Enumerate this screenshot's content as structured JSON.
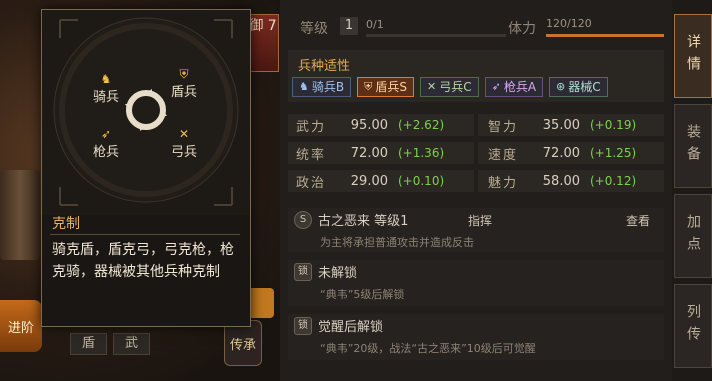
{
  "background": {
    "left_badge": "进阶",
    "red_tag": "御 7",
    "sub_tabs": [
      "盾",
      "武"
    ],
    "chuan": "传承"
  },
  "header": {
    "level_label": "等级",
    "level_value": "1",
    "level_progress": "0/1",
    "stamina_label": "体力",
    "stamina_value": "120/120",
    "stamina_fill": 1.0
  },
  "troop_affinity": {
    "title": "兵种适性",
    "chips": [
      {
        "label": "骑兵B",
        "icon": "horse-icon"
      },
      {
        "label": "盾兵S",
        "icon": "shield-icon",
        "active": true
      },
      {
        "label": "弓兵C",
        "icon": "bow-icon"
      },
      {
        "label": "枪兵A",
        "icon": "spear-icon"
      },
      {
        "label": "器械C",
        "icon": "siege-icon"
      }
    ]
  },
  "stats": [
    {
      "label": "武力",
      "value": "95.00",
      "bonus": "(+2.62)"
    },
    {
      "label": "智力",
      "value": "35.00",
      "bonus": "(+0.19)"
    },
    {
      "label": "统率",
      "value": "72.00",
      "bonus": "(+1.36)"
    },
    {
      "label": "速度",
      "value": "72.00",
      "bonus": "(+1.25)"
    },
    {
      "label": "政治",
      "value": "29.00",
      "bonus": "(+0.10)"
    },
    {
      "label": "魅力",
      "value": "58.00",
      "bonus": "(+0.12)"
    }
  ],
  "skills": [
    {
      "icon": "S",
      "name": "古之恶来 等级1",
      "type": "指挥",
      "view": "查看",
      "desc": "为主将承担普通攻击并造成反击"
    },
    {
      "icon": "锁",
      "name": "未解锁",
      "desc": "“典韦”5级后解锁"
    },
    {
      "icon": "锁",
      "name": "觉醒后解锁",
      "desc": "“典韦”20级，战法“古之恶来”10级后可觉醒"
    }
  ],
  "side_tabs": [
    "详情",
    "装备",
    "加点",
    "列传"
  ],
  "popup": {
    "units": {
      "cavalry": "骑兵",
      "shield": "盾兵",
      "spear": "枪兵",
      "archer": "弓兵"
    },
    "title": "克制",
    "text": "骑克盾，盾克弓，弓克枪，枪克骑，器械被其他兵种克制"
  },
  "colors": {
    "accent": "#e4ad52",
    "bonus_green": "#7fcf55",
    "active_chip": "#e07a2a"
  }
}
